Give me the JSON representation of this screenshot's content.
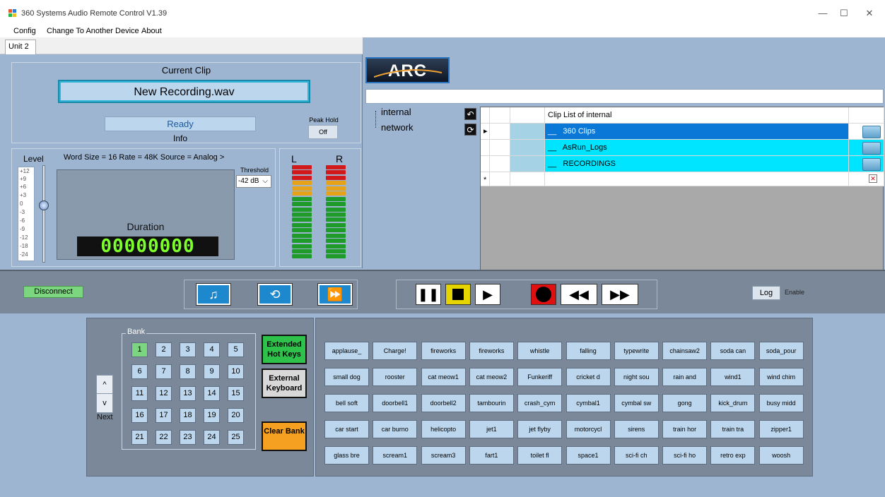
{
  "window": {
    "title": "360 Systems Audio Remote Control V1.39",
    "min": "—",
    "max": "☐",
    "close": "✕"
  },
  "menu": {
    "config": "Config",
    "change": "Change To Another Device",
    "about": "About"
  },
  "tabs": {
    "unit2": "Unit 2"
  },
  "clip": {
    "heading": "Current Clip",
    "name": "New Recording.wav",
    "status": "Ready",
    "info": "Info",
    "peak_hold": "Peak Hold",
    "peak_btn": "Off"
  },
  "level": {
    "label": "Level",
    "format": "Word Size = 16   Rate = 48K   Source = Analog >",
    "scale": [
      "+12",
      "+9",
      "+6",
      "+3",
      "0",
      "-3",
      "-6",
      "-9",
      "-12",
      "-18",
      "-24"
    ],
    "threshold_label": "Threshold",
    "threshold_value": "-42 dB",
    "duration_label": "Duration",
    "duration_value": "00000000"
  },
  "meters": {
    "left": "L",
    "right": "R"
  },
  "browser": {
    "logo": "ARC",
    "tree": [
      "internal",
      "network"
    ],
    "grid_header": "Clip List of internal",
    "rows": [
      "360 Clips",
      "AsRun_Logs",
      "RECORDINGS"
    ],
    "new_row_marker": "*",
    "undo_icon": "↶",
    "refresh_icon": "⟳"
  },
  "transport": {
    "disconnect": "Disconnect",
    "log": "Log",
    "enable": "Enable"
  },
  "bank": {
    "title": "Bank",
    "keys": [
      "1",
      "2",
      "3",
      "4",
      "5",
      "6",
      "7",
      "8",
      "9",
      "10",
      "11",
      "12",
      "13",
      "14",
      "15",
      "16",
      "17",
      "18",
      "19",
      "20",
      "21",
      "22",
      "23",
      "24",
      "25"
    ],
    "selected": "1",
    "up": "^",
    "down": "v",
    "next": "Next",
    "extended": "Extended Hot Keys",
    "external": "External Keyboard",
    "clear": "Clear Bank"
  },
  "hotkeys": [
    "applause_",
    "Charge!",
    "fireworks",
    "fireworks",
    "whistle",
    "falling",
    "typewrite",
    "chainsaw2",
    "soda can",
    "soda_pour",
    "small dog",
    "rooster",
    "cat meow1",
    "cat meow2",
    "Funkeriff",
    "cricket d",
    "night sou",
    "rain and",
    "wind1",
    "wind chim",
    "bell soft",
    "doorbell1",
    "doorbell2",
    "tambourin",
    "crash_cym",
    "cymbal1",
    "cymbal sw",
    "gong",
    "kick_drum",
    "busy midd",
    "car start",
    "car burno",
    "helicopto",
    "jet1",
    "jet flyby",
    "motorcycl",
    "sirens",
    "train hor",
    "train tra",
    "zipper1",
    "glass bre",
    "scream1",
    "scream3",
    "fart1",
    "toilet fl",
    "space1",
    "sci-fi ch",
    "sci-fi ho",
    "retro exp",
    "woosh"
  ],
  "colors": {
    "background": "#9eb5d1",
    "panel": "#7b8899",
    "cyan_row": "#00e5ff",
    "selected_row": "#0a78d7",
    "accent_green": "#7cd67f",
    "transport_blue": "#1e88cf"
  }
}
